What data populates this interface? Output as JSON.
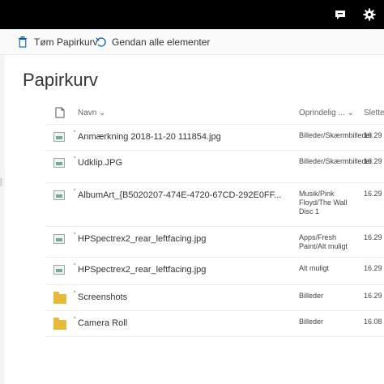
{
  "toolbar": {
    "empty_label": "Tøm Papirkurv",
    "restore_label": "Gendan alle elementer"
  },
  "page": {
    "title": "Papirkurv"
  },
  "columns": {
    "name": "Navn",
    "original_location": "Oprindelig ...",
    "deleted": "Slettet"
  },
  "rows": [
    {
      "name": "Anmærkning 2018-11-20 111854.jpg",
      "location": "Billeder/Skærmbilleder",
      "date": "16.29",
      "type": "image"
    },
    {
      "name": "Udklip.JPG",
      "location": "Billeder/Skærmbilleder",
      "date": "16.29",
      "type": "image"
    },
    {
      "name": "AlbumArt_{B5020207-474E-4720-67CD-292E0FF...",
      "location": "Musik/Pink Floyd/The Wall Disc 1",
      "date": "16.29",
      "type": "image"
    },
    {
      "name": "HPSpectrex2_rear_leftfacing.jpg",
      "location": "Apps/Fresh Paint/Alt muligt",
      "date": "16.29",
      "type": "image"
    },
    {
      "name": "HPSpectrex2_rear_leftfacing.jpg",
      "location": "Alt muligt",
      "date": "16.29",
      "type": "image"
    },
    {
      "name": "Screenshots",
      "location": "Billeder",
      "date": "16.29",
      "type": "folder"
    },
    {
      "name": "Camera Roll",
      "location": "Billeder",
      "date": "16.08",
      "type": "folder"
    }
  ],
  "icons": {
    "feedback": "feedback-icon",
    "settings": "gear-icon",
    "empty": "trash-icon",
    "restore": "undo-icon"
  }
}
